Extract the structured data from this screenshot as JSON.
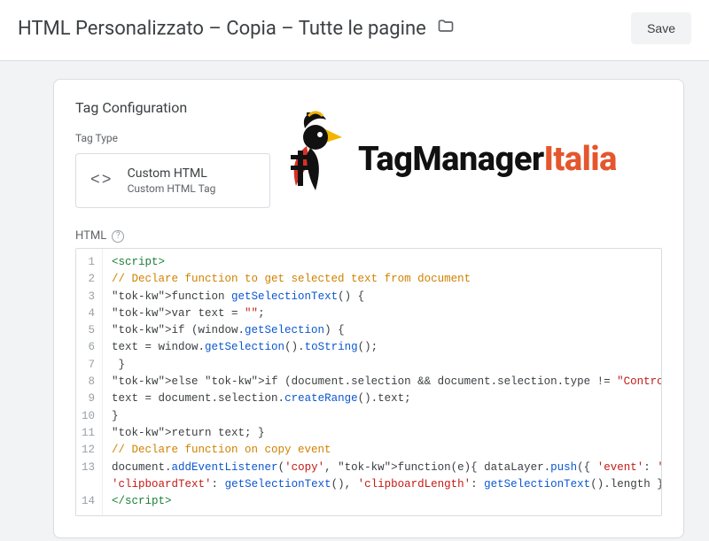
{
  "header": {
    "title": "HTML Personalizzato – Copia – Tutte le pagine",
    "save_label": "Save"
  },
  "card": {
    "title": "Tag Configuration",
    "tag_type_label": "Tag Type",
    "tag_type": {
      "name": "Custom HTML",
      "subtitle": "Custom HTML Tag"
    },
    "html_label": "HTML",
    "code_lines": [
      "<script>",
      "// Declare function to get selected text from document",
      "function getSelectionText() {",
      "var text = \"\";",
      "if (window.getSelection) {",
      "text = window.getSelection().toString();",
      " }",
      "else if (document.selection && document.selection.type != \"Control\") {",
      "text = document.selection.createRange().text;",
      "}",
      "return text; }",
      "// Declare function on copy event",
      "document.addEventListener('copy', function(e){ dataLayer.push({ 'event': 'textCopied', 'clipboardText': getSelectionText(), 'clipboardLength': getSelectionText().length }); });",
      "</script>"
    ]
  },
  "logo": {
    "part1": "TagManager",
    "part2": "Italia"
  }
}
